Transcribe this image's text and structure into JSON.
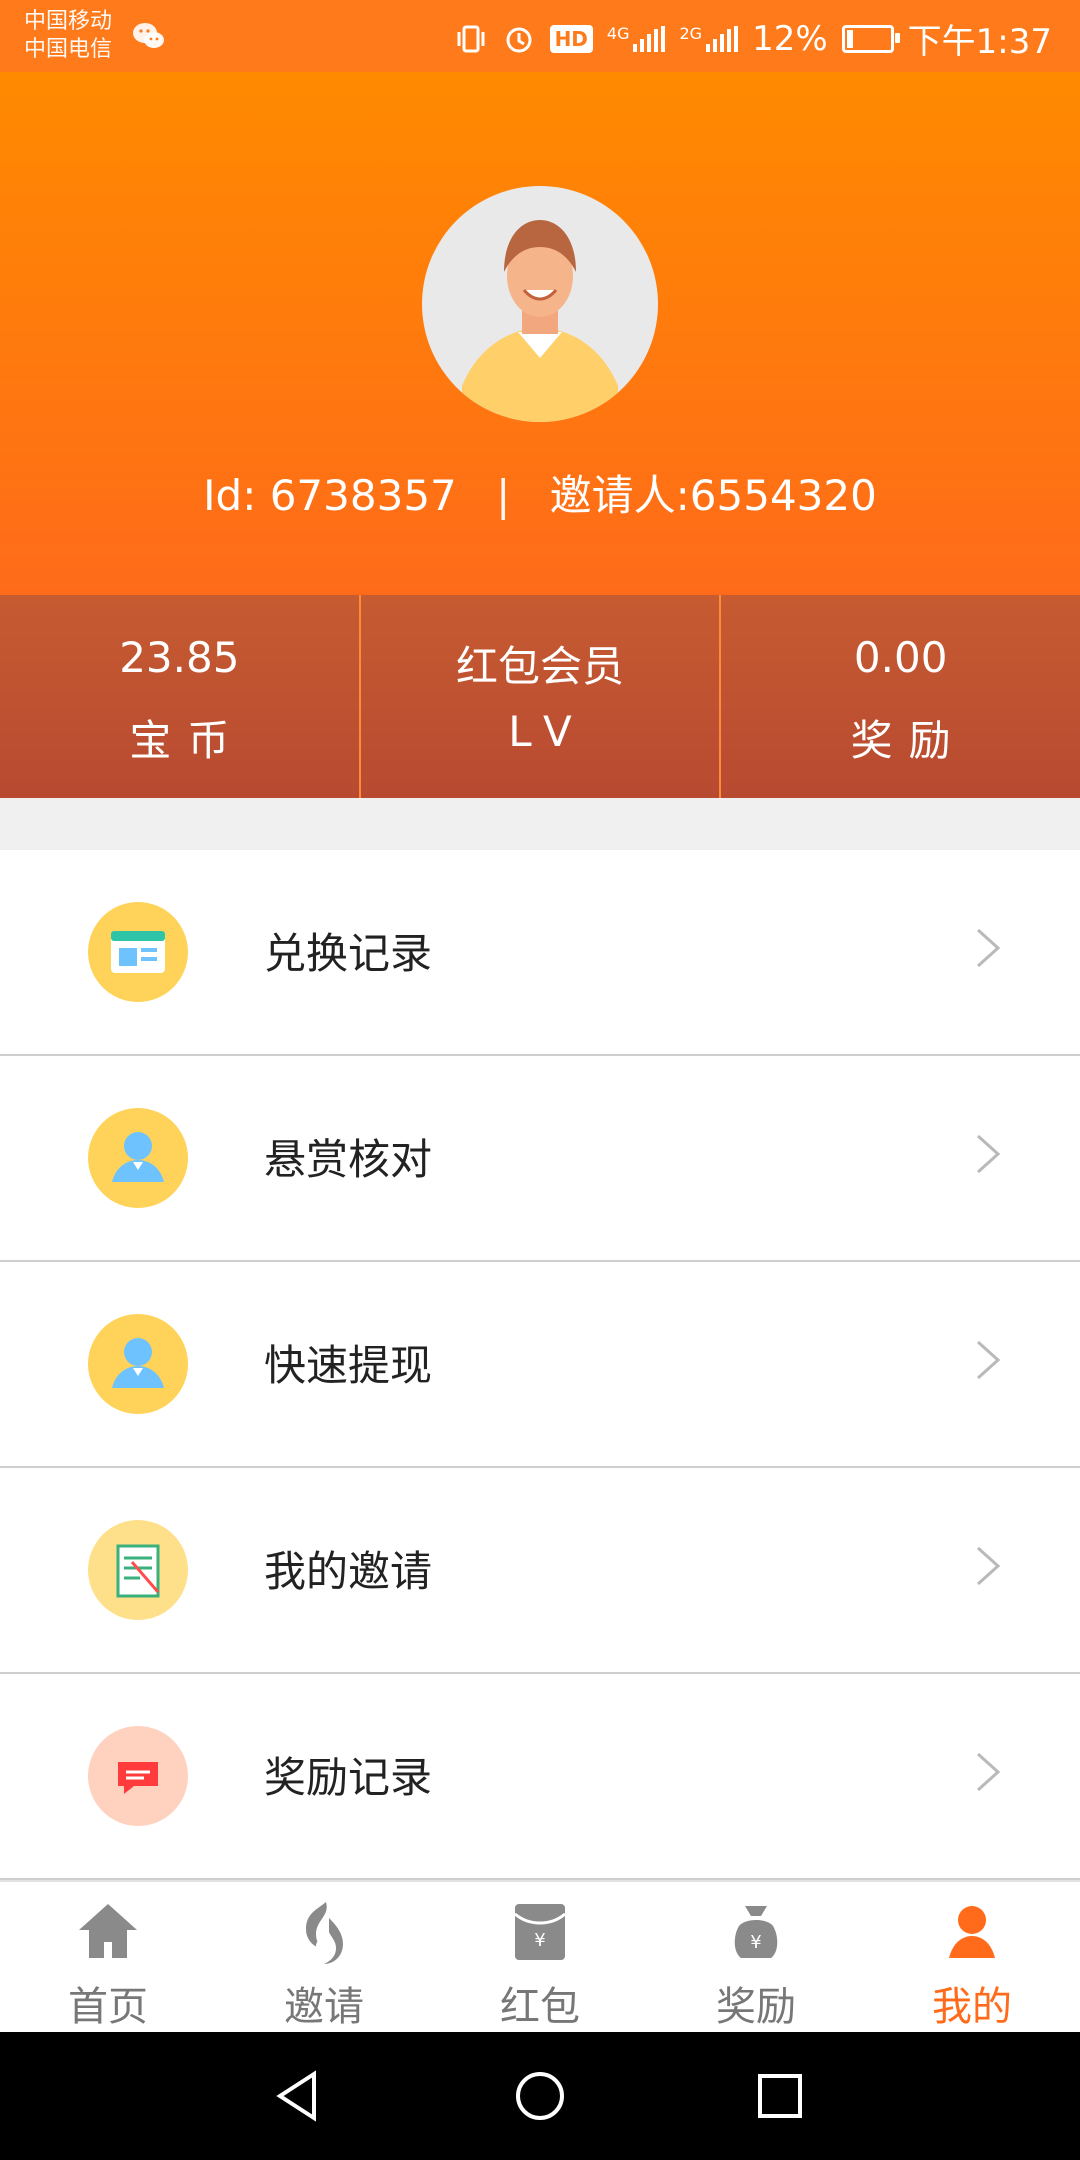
{
  "status_bar": {
    "carrier_1": "中国移动",
    "carrier_2": "中国电信",
    "network_1": "4G",
    "network_2": "2G",
    "battery_percent": "12%",
    "time": "下午1:37"
  },
  "profile": {
    "id_text": "Id: 6738357",
    "inviter_text": "邀请人:6554320",
    "separator": "|"
  },
  "stats": [
    {
      "value": "23.85",
      "label": "宝币"
    },
    {
      "value": "红包会员",
      "label": "LV"
    },
    {
      "value": "0.00",
      "label": "奖励"
    }
  ],
  "menu": [
    {
      "label": "兑换记录",
      "icon": "calendar-icon",
      "icon_bg": "#ffd35a"
    },
    {
      "label": "悬赏核对",
      "icon": "user-icon",
      "icon_bg": "#ffd35a"
    },
    {
      "label": "快速提现",
      "icon": "user-icon",
      "icon_bg": "#ffd35a"
    },
    {
      "label": "我的邀请",
      "icon": "notebook-icon",
      "icon_bg": "#ffe08a"
    },
    {
      "label": "奖励记录",
      "icon": "message-icon",
      "icon_bg": "#ffd1bf"
    }
  ],
  "bottom_nav": [
    {
      "label": "首页",
      "icon": "home-icon",
      "active": false
    },
    {
      "label": "邀请",
      "icon": "flame-icon",
      "active": false
    },
    {
      "label": "红包",
      "icon": "red-envelope-icon",
      "active": false
    },
    {
      "label": "奖励",
      "icon": "money-bag-icon",
      "active": false
    },
    {
      "label": "我的",
      "icon": "person-icon",
      "active": true
    }
  ],
  "colors": {
    "accent": "#ff7a1a",
    "header_top": "#ff8a00",
    "stats_bg": "#b84a31",
    "inactive_nav": "#777777",
    "active_nav": "#ff6b1a"
  }
}
